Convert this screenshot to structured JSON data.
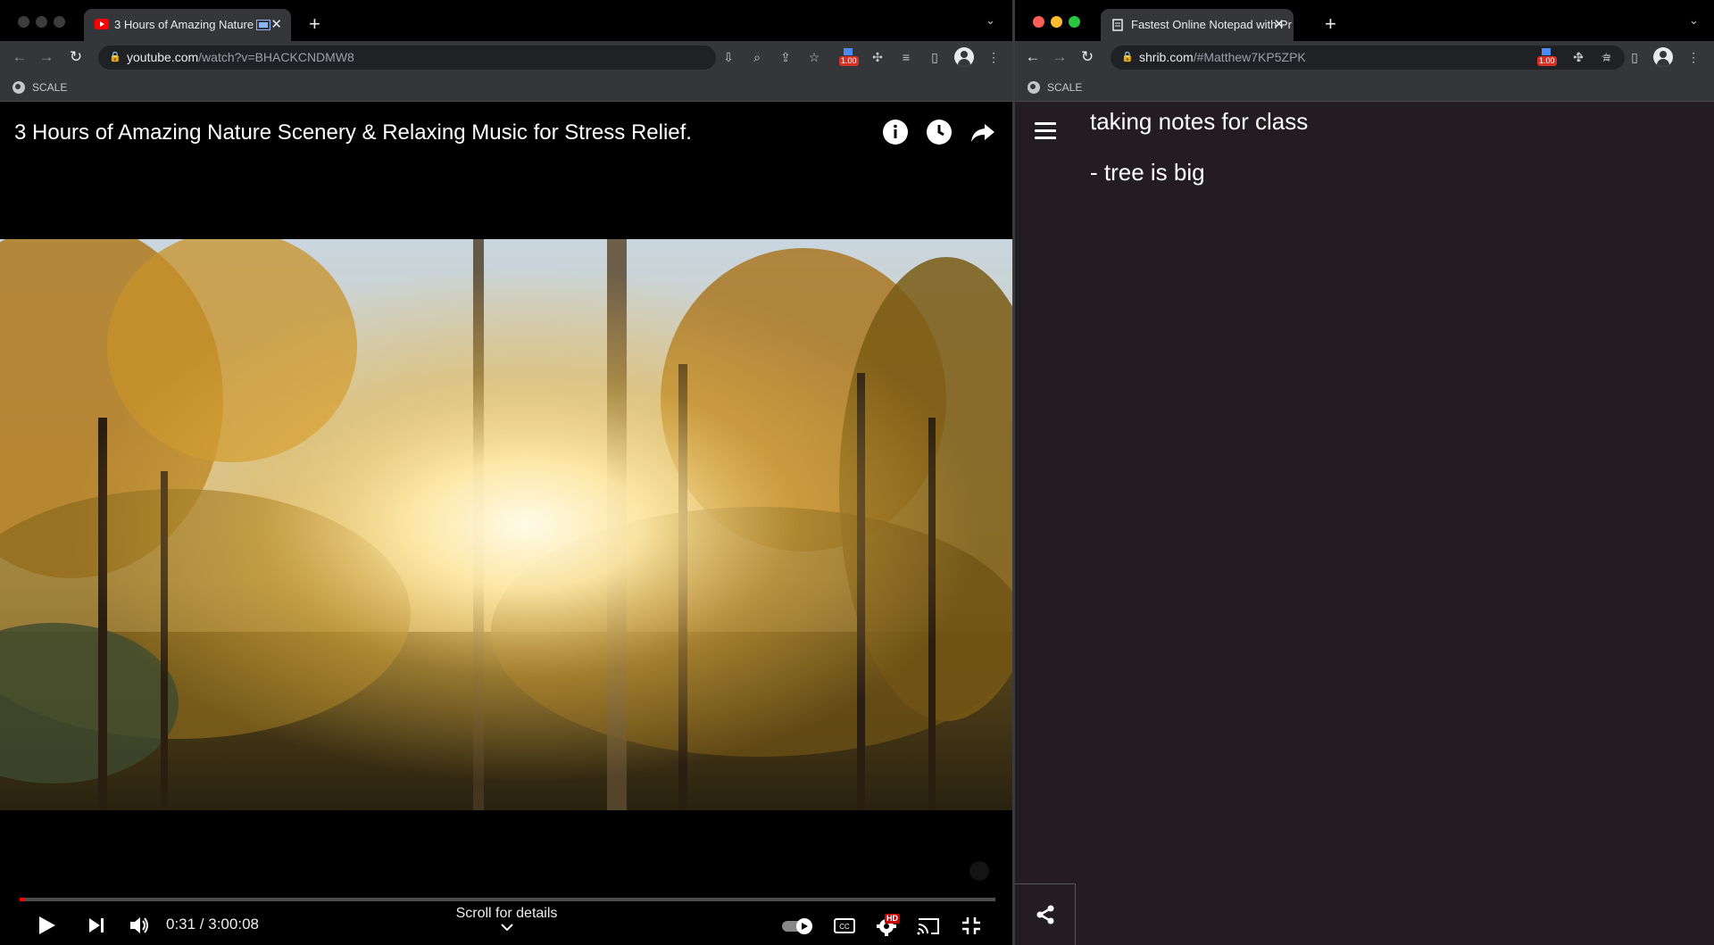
{
  "left_window": {
    "tab_title": "3 Hours of Amazing Nature",
    "url_host": "youtube.com",
    "url_path": "/watch?v=BHACKCNDMW8",
    "extension_badge": "1.00",
    "bookmark_label": "SCALE",
    "player": {
      "video_title": "3 Hours of Amazing Nature Scenery & Relaxing Music for Stress Relief.",
      "time_display": "0:31 / 3:00:08",
      "progress_fraction": 0.003,
      "scroll_hint": "Scroll for details",
      "hd_badge": "HD"
    }
  },
  "right_window": {
    "tab_title": "Fastest Online Notepad with Pr",
    "url_host": "shrib.com",
    "url_path": "/#Matthew7KP5ZPK",
    "extension_badge": "1.00",
    "bookmark_label": "SCALE",
    "notes": {
      "line1": "taking notes for class",
      "line2": "- tree is big"
    }
  },
  "colors": {
    "chrome_toolbar": "#35363a",
    "notepad_bg": "#231c22",
    "youtube_red": "#ff0000"
  }
}
